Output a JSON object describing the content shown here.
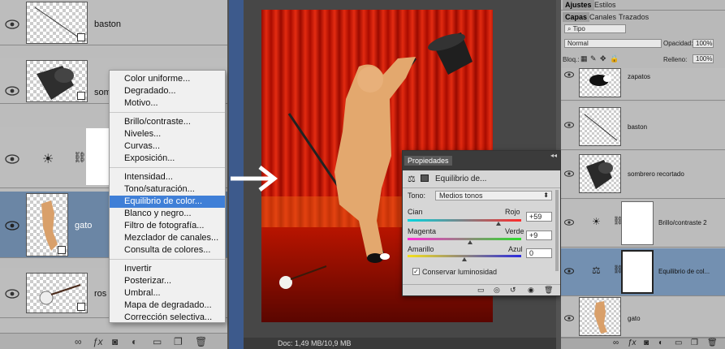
{
  "left_panel": {
    "layers": [
      {
        "name": "baston"
      },
      {
        "name": "som"
      },
      {
        "name": ""
      },
      {
        "name": "gato"
      },
      {
        "name": "ros"
      }
    ],
    "bottom_icons": [
      "link-icon",
      "fx-icon",
      "mask-icon",
      "adjustment-icon",
      "folder-icon",
      "new-layer-icon",
      "trash-icon"
    ]
  },
  "menu": {
    "items": [
      "Color uniforme...",
      "Degradado...",
      "Motivo...",
      "Brillo/contraste...",
      "Niveles...",
      "Curvas...",
      "Exposición...",
      "Intensidad...",
      "Tono/saturación...",
      "Equilibrio de color...",
      "Blanco y negro...",
      "Filtro de fotografía...",
      "Mezclador de canales...",
      "Consulta de colores...",
      "Invertir",
      "Posterizar...",
      "Umbral...",
      "Mapa de degradado...",
      "Corrección selectiva..."
    ],
    "highlighted": "Equilibrio de color..."
  },
  "canvas": {
    "doc_info": "Doc: 1,49 MB/10,9 MB"
  },
  "properties": {
    "tab": "Propiedades",
    "title": "Equilibrio de...",
    "tone_label": "Tono:",
    "tone_value": "Medios tonos",
    "sliders": [
      {
        "left": "Cian",
        "right": "Rojo",
        "value": "+59",
        "position": 0.8
      },
      {
        "left": "Magenta",
        "right": "Verde",
        "value": "+9",
        "position": 0.55
      },
      {
        "left": "Amarillo",
        "right": "Azul",
        "value": "0",
        "position": 0.5
      }
    ],
    "preserve_label": "Conservar luminosidad",
    "preserve_checked": true
  },
  "right_panel": {
    "top_tabs": [
      "Ajustes",
      "Estilos"
    ],
    "tabs": [
      "Capas",
      "Canales",
      "Trazados"
    ],
    "filter_label": "Tipo",
    "blend_mode": "Normal",
    "opacity_label": "Opacidad:",
    "opacity_value": "100%",
    "lock_label": "Bloq.:",
    "fill_label": "Relleno:",
    "fill_value": "100%",
    "layers": [
      {
        "name": "zapatos"
      },
      {
        "name": "baston"
      },
      {
        "name": "sombrero recortado"
      },
      {
        "name": "Brillo/contraste 2"
      },
      {
        "name": "Equilibrio de col..."
      },
      {
        "name": "gato"
      }
    ]
  },
  "colors": {
    "selection": "#6b86a5",
    "menu_highlight": "#3f7fd7",
    "curtain_red": "#c41000"
  }
}
